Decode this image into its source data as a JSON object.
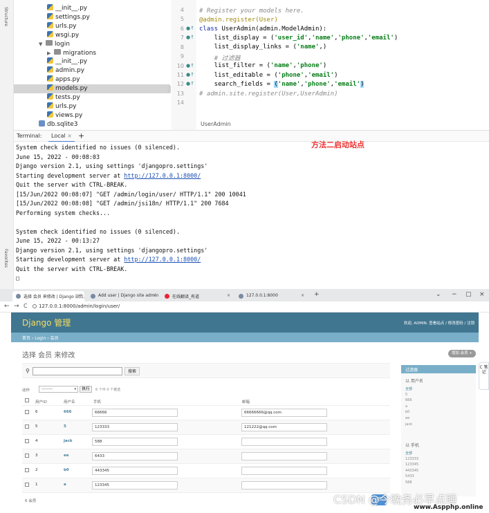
{
  "ide": {
    "left_strip_labels": [
      "Structure",
      "Favorites"
    ],
    "tree": [
      {
        "type": "py",
        "label": "__init__.py",
        "indent": 2
      },
      {
        "type": "py",
        "label": "settings.py",
        "indent": 2
      },
      {
        "type": "py",
        "label": "urls.py",
        "indent": 2
      },
      {
        "type": "py",
        "label": "wsgi.py",
        "indent": 2
      },
      {
        "type": "folder-open",
        "label": "login",
        "indent": 1
      },
      {
        "type": "folder",
        "label": "migrations",
        "indent": 2
      },
      {
        "type": "py",
        "label": "__init__.py",
        "indent": 2
      },
      {
        "type": "py",
        "label": "admin.py",
        "indent": 2
      },
      {
        "type": "py",
        "label": "apps.py",
        "indent": 2
      },
      {
        "type": "py",
        "label": "models.py",
        "indent": 2,
        "selected": true
      },
      {
        "type": "py",
        "label": "tests.py",
        "indent": 2
      },
      {
        "type": "py",
        "label": "urls.py",
        "indent": 2
      },
      {
        "type": "py",
        "label": "views.py",
        "indent": 2
      },
      {
        "type": "db",
        "label": "db.sqlite3",
        "indent": 1
      }
    ],
    "line_numbers": [
      "6",
      "7",
      "8",
      "9",
      "10",
      "11",
      "12",
      "13",
      "14"
    ],
    "line_numbers_first": "4",
    "breadcrumb": "UserAdmin"
  },
  "code": {
    "l4": "# Register your models here.",
    "l5": "@admin.register(User)",
    "l6_kw": "class",
    "l6_rest": " UserAdmin(admin.ModelAdmin):",
    "l7_a": "    list_display = (",
    "l7_b": "'user_id'",
    "l7_c": ",",
    "l7_d": "'name'",
    "l7_e": ",",
    "l7_f": "'phone'",
    "l7_g": ",",
    "l7_h": "'email'",
    "l7_i": ")",
    "l8_a": "    list_display_links = (",
    "l8_b": "'name'",
    "l8_c": ",)",
    "l9": "    # 过滤器",
    "l10_a": "    list_filter = (",
    "l10_b": "'name'",
    "l10_c": ",",
    "l10_d": "'phone'",
    "l10_e": ")",
    "l11_a": "    list_editable = (",
    "l11_b": "'phone'",
    "l11_c": ",",
    "l11_d": "'email'",
    "l11_e": ")",
    "l12_a": "    search_fields = ",
    "l12_b": "(",
    "l12_c": "'name'",
    "l12_d": ",",
    "l12_e": "'phone'",
    "l12_f": ",",
    "l12_g": "'email'",
    "l12_h": ")",
    "l13": "# admin.site.register(User,UserAdmin)"
  },
  "terminal": {
    "tab_label": "Terminal:",
    "local_tab": "Local",
    "close": "×",
    "add": "+",
    "note": "方法二启动站点",
    "lines": [
      "System check identified no issues (0 silenced).",
      "June 15, 2022 - 00:08:03",
      "Django version 2.1, using settings 'djangopro.settings'",
      "Starting development server at ",
      "Quit the server with CTRL-BREAK.",
      "[15/Jun/2022 00:08:07] \"GET /admin/login/user/ HTTP/1.1\" 200 10041",
      "[15/Jun/2022 00:08:08] \"GET /admin/jsi18n/ HTTP/1.1\" 200 7684",
      "Performing system checks...",
      "",
      "System check identified no issues (0 silenced).",
      "June 15, 2022 - 00:13:27",
      "Django version 2.1, using settings 'djangopro.settings'",
      "Starting development server at ",
      "Quit the server with CTRL-BREAK.",
      "□"
    ],
    "link": "http://127.0.0.1:8000/"
  },
  "browser": {
    "tabs": [
      "选择 会员 来修改 | Django 站点...",
      "Add user | Django site admin",
      "在线翻译_有道",
      "127.0.0.1:8000"
    ],
    "new_tab": "+",
    "win_controls": [
      "⌄",
      "−",
      "▢",
      "×"
    ],
    "url": "127.0.0.1:8000/admin/login/user/",
    "nav": [
      "←",
      "→",
      "C"
    ],
    "brand": "Django 管理",
    "user_tools": "欢迎, ADMIN. 查看站点 / 修改密码 / 注销",
    "crumbs": "首页 › Login › 会员",
    "page_title": "选择 会员 来修改",
    "add_button": "增加 会员 +",
    "search_button": "搜索",
    "actions_label": "动作",
    "action_select": "---------",
    "go_button": "执行",
    "selected_count": "6 个中 0 个被选",
    "columns": [
      "用户ID",
      "用户名",
      "手机",
      "邮箱"
    ],
    "rows": [
      {
        "id": "6",
        "name": "666",
        "phone": "66666",
        "email": "66666666@qq.com"
      },
      {
        "id": "5",
        "name": "5",
        "phone": "123333",
        "email": "121222@qq.com"
      },
      {
        "id": "4",
        "name": "jack",
        "phone": "588",
        "email": ""
      },
      {
        "id": "3",
        "name": "ee",
        "phone": "6433",
        "email": ""
      },
      {
        "id": "2",
        "name": "b0",
        "phone": "443345",
        "email": ""
      },
      {
        "id": "1",
        "name": "a",
        "phone": "123345",
        "email": ""
      }
    ],
    "row_count": "6 会员",
    "filter": {
      "title": "过滤器",
      "by_name": "以 用户名",
      "name_items": [
        "全部",
        "5",
        "666",
        "a",
        "b0",
        "ee",
        "jack"
      ],
      "by_phone": "以 手机",
      "phone_items": [
        "全部",
        "123333",
        "123345",
        "443345",
        "5433",
        "588"
      ]
    },
    "float_tool": "C 笔 记",
    "chat_button": "回",
    "watermark": "CSDN @今晚务必早点睡",
    "watermark_site": "www.Aspphp.online"
  },
  "colors": {
    "django_header": "#417690",
    "django_breadcrumb": "#79aec8",
    "brand_yellow": "#f5dd5d",
    "note_red": "#ee3333"
  }
}
